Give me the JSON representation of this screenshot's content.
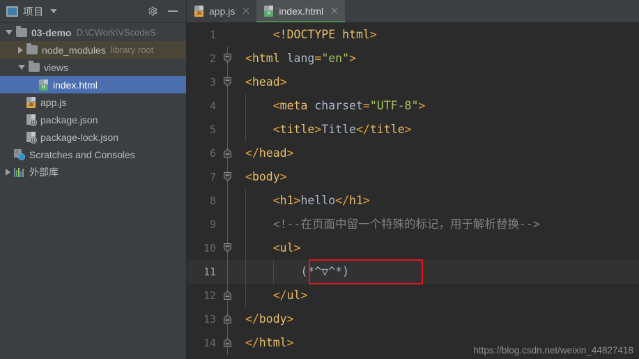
{
  "sidebar": {
    "header": {
      "title": "项目",
      "window_icon": "window-icon",
      "dropdown_icon": "chevron-down-icon",
      "settings_icon": "gear-icon",
      "minimize_icon": "minimize-icon"
    },
    "tree": [
      {
        "label": "03-demo",
        "sub": "D:\\CWork\\VScodeS",
        "icon": "folder-icon",
        "twisty": "open",
        "depth": 0,
        "bold": true,
        "state": "normal"
      },
      {
        "label": "node_modules",
        "sub": "library root",
        "icon": "folder-icon",
        "twisty": "closed",
        "depth": 1,
        "bold": false,
        "state": "highlight"
      },
      {
        "label": "views",
        "sub": "",
        "icon": "folder-icon",
        "twisty": "open",
        "depth": 1,
        "bold": false,
        "state": "normal"
      },
      {
        "label": "index.html",
        "sub": "",
        "icon": "html-file-icon",
        "twisty": "none",
        "depth": 2,
        "bold": false,
        "state": "selected"
      },
      {
        "label": "app.js",
        "sub": "",
        "icon": "js-file-icon",
        "twisty": "none",
        "depth": 1,
        "bold": false,
        "state": "normal"
      },
      {
        "label": "package.json",
        "sub": "",
        "icon": "json-file-icon",
        "twisty": "none",
        "depth": 1,
        "bold": false,
        "state": "normal"
      },
      {
        "label": "package-lock.json",
        "sub": "",
        "icon": "json-file-icon",
        "twisty": "none",
        "depth": 1,
        "bold": false,
        "state": "normal"
      },
      {
        "label": "Scratches and Consoles",
        "sub": "",
        "icon": "scratches-icon",
        "twisty": "none",
        "depth": 0,
        "bold": false,
        "state": "normal"
      },
      {
        "label": "外部库",
        "sub": "",
        "icon": "external-libraries-icon",
        "twisty": "closed",
        "depth": 0,
        "bold": false,
        "state": "normal"
      }
    ]
  },
  "tabs": [
    {
      "label": "app.js",
      "icon": "js-file-icon",
      "active": false,
      "close_icon": "close-icon"
    },
    {
      "label": "index.html",
      "icon": "html-file-icon",
      "active": true,
      "close_icon": "close-icon"
    }
  ],
  "editor": {
    "current_line": 11,
    "lines": [
      {
        "n": "1",
        "fold": "none",
        "indent_guides": 0,
        "tokens": [
          {
            "t": "punct",
            "v": "    <"
          },
          {
            "t": "tag",
            "v": "!DOCTYPE html"
          },
          {
            "t": "punct",
            "v": ">"
          }
        ]
      },
      {
        "n": "2",
        "fold": "open",
        "indent_guides": 0,
        "tokens": [
          {
            "t": "punct",
            "v": "<"
          },
          {
            "t": "tag",
            "v": "html"
          },
          {
            "t": "text",
            "v": " "
          },
          {
            "t": "attr",
            "v": "lang"
          },
          {
            "t": "punct",
            "v": "="
          },
          {
            "t": "val",
            "v": "\"en\""
          },
          {
            "t": "punct",
            "v": ">"
          }
        ]
      },
      {
        "n": "3",
        "fold": "open",
        "indent_guides": 0,
        "tokens": [
          {
            "t": "punct",
            "v": "<"
          },
          {
            "t": "tag",
            "v": "head"
          },
          {
            "t": "punct",
            "v": ">"
          }
        ]
      },
      {
        "n": "4",
        "fold": "none",
        "indent_guides": 1,
        "tokens": [
          {
            "t": "punct",
            "v": "    <"
          },
          {
            "t": "tag",
            "v": "meta"
          },
          {
            "t": "text",
            "v": " "
          },
          {
            "t": "attr",
            "v": "charset"
          },
          {
            "t": "punct",
            "v": "="
          },
          {
            "t": "val",
            "v": "\"UTF-8\""
          },
          {
            "t": "punct",
            "v": ">"
          }
        ]
      },
      {
        "n": "5",
        "fold": "none",
        "indent_guides": 1,
        "tokens": [
          {
            "t": "punct",
            "v": "    <"
          },
          {
            "t": "tag",
            "v": "title"
          },
          {
            "t": "punct",
            "v": ">"
          },
          {
            "t": "text",
            "v": "Title"
          },
          {
            "t": "punct",
            "v": "</"
          },
          {
            "t": "tag",
            "v": "title"
          },
          {
            "t": "punct",
            "v": ">"
          }
        ]
      },
      {
        "n": "6",
        "fold": "close",
        "indent_guides": 0,
        "tokens": [
          {
            "t": "punct",
            "v": "</"
          },
          {
            "t": "tag",
            "v": "head"
          },
          {
            "t": "punct",
            "v": ">"
          }
        ]
      },
      {
        "n": "7",
        "fold": "open",
        "indent_guides": 0,
        "tokens": [
          {
            "t": "punct",
            "v": "<"
          },
          {
            "t": "tag",
            "v": "body"
          },
          {
            "t": "punct",
            "v": ">"
          }
        ]
      },
      {
        "n": "8",
        "fold": "none",
        "indent_guides": 1,
        "tokens": [
          {
            "t": "punct",
            "v": "    <"
          },
          {
            "t": "tag",
            "v": "h1"
          },
          {
            "t": "punct",
            "v": ">"
          },
          {
            "t": "text",
            "v": "hello"
          },
          {
            "t": "punct",
            "v": "</"
          },
          {
            "t": "tag",
            "v": "h1"
          },
          {
            "t": "punct",
            "v": ">"
          }
        ]
      },
      {
        "n": "9",
        "fold": "none",
        "indent_guides": 1,
        "tokens": [
          {
            "t": "comment",
            "v": "    <!--在页面中留一个特殊的标记，用于解析替换-->"
          }
        ]
      },
      {
        "n": "10",
        "fold": "open",
        "indent_guides": 1,
        "tokens": [
          {
            "t": "punct",
            "v": "    <"
          },
          {
            "t": "tag",
            "v": "ul"
          },
          {
            "t": "punct",
            "v": ">"
          }
        ]
      },
      {
        "n": "11",
        "fold": "none",
        "indent_guides": 2,
        "tokens": [
          {
            "t": "text",
            "v": "        (*^▽^*)"
          }
        ]
      },
      {
        "n": "12",
        "fold": "close",
        "indent_guides": 1,
        "tokens": [
          {
            "t": "punct",
            "v": "    </"
          },
          {
            "t": "tag",
            "v": "ul"
          },
          {
            "t": "punct",
            "v": ">"
          }
        ]
      },
      {
        "n": "13",
        "fold": "close",
        "indent_guides": 0,
        "tokens": [
          {
            "t": "punct",
            "v": "</"
          },
          {
            "t": "tag",
            "v": "body"
          },
          {
            "t": "punct",
            "v": ">"
          }
        ]
      },
      {
        "n": "14",
        "fold": "close",
        "indent_guides": 0,
        "tokens": [
          {
            "t": "punct",
            "v": "</"
          },
          {
            "t": "tag",
            "v": "html"
          },
          {
            "t": "punct",
            "v": ">"
          }
        ]
      }
    ]
  },
  "annotation": {
    "type": "red-rectangle",
    "color": "#e81123",
    "target_line": 11
  },
  "watermark": "https://blog.csdn.net/weixin_44827418",
  "colors": {
    "sidebar_bg": "#3c3f41",
    "editor_bg": "#2b2b2b",
    "selection_blue": "#4b6eaf",
    "tag_yellow": "#e8bf6a",
    "punct_orange": "#e8a33d",
    "value_green": "#a5c261",
    "text_bluegray": "#a9b7c6",
    "comment_gray": "#808080",
    "accent_green": "#4f8a53"
  }
}
